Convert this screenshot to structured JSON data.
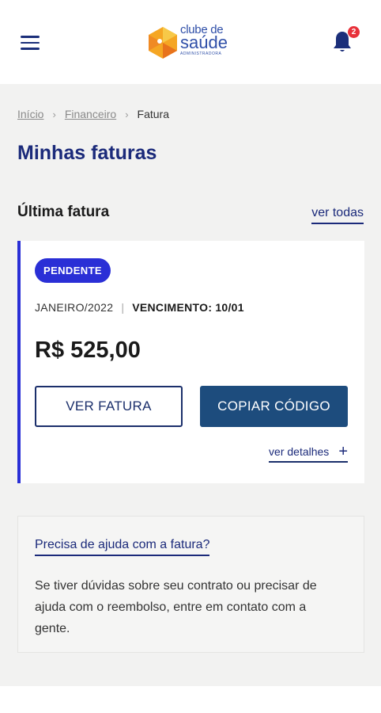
{
  "header": {
    "logo": {
      "top": "clube de",
      "main": "saúde",
      "sub": "ADMINISTRADORA"
    },
    "notification_count": "2",
    "colors": {
      "brand": "#1b2a7a",
      "badge": "#e8313a"
    }
  },
  "breadcrumb": {
    "items": [
      {
        "label": "Início"
      },
      {
        "label": "Financeiro"
      }
    ],
    "current": "Fatura"
  },
  "page_title": "Minhas faturas",
  "last_invoice": {
    "section_title": "Última fatura",
    "see_all_label": "ver todas",
    "status": "PENDENTE",
    "period": "JANEIRO/2022",
    "due_label": "VENCIMENTO:",
    "due_date": "10/01",
    "amount": "R$ 525,00",
    "view_button": "VER FATURA",
    "copy_button": "COPIAR CÓDIGO",
    "details_label": "ver detalhes",
    "colors": {
      "accent": "#2a2fd6",
      "button": "#1d4c7d"
    }
  },
  "help": {
    "title": "Precisa de ajuda com a fatura?",
    "text": "Se tiver dúvidas sobre seu contrato ou precisar de ajuda com o reembolso, entre em contato com a gente."
  }
}
